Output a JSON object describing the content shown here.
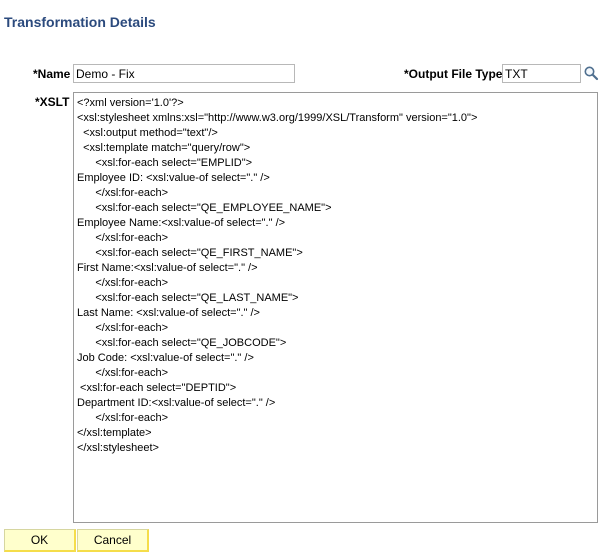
{
  "page": {
    "title": "Transformation Details"
  },
  "form": {
    "name_label": "*Name",
    "name_value": "Demo - Fix",
    "output_file_type_label": "*Output File Type",
    "output_file_type_value": "TXT",
    "lookup_icon": "magnifier-icon",
    "xslt_label": "*XSLT",
    "xslt_value": "<?xml version='1.0'?>\n<xsl:stylesheet xmlns:xsl=\"http://www.w3.org/1999/XSL/Transform\" version=\"1.0\">\n  <xsl:output method=\"text\"/>\n  <xsl:template match=\"query/row\">\n      <xsl:for-each select=\"EMPLID\">\nEmployee ID: <xsl:value-of select=\".\" />\n      </xsl:for-each>\n      <xsl:for-each select=\"QE_EMPLOYEE_NAME\">\nEmployee Name:<xsl:value-of select=\".\" />\n      </xsl:for-each>\n      <xsl:for-each select=\"QE_FIRST_NAME\">\nFirst Name:<xsl:value-of select=\".\" />\n      </xsl:for-each>\n      <xsl:for-each select=\"QE_LAST_NAME\">\nLast Name: <xsl:value-of select=\".\" />\n      </xsl:for-each>\n      <xsl:for-each select=\"QE_JOBCODE\">\nJob Code: <xsl:value-of select=\".\" />\n      </xsl:for-each>\n <xsl:for-each select=\"DEPTID\">\nDepartment ID:<xsl:value-of select=\".\" />\n      </xsl:for-each>\n</xsl:template>\n</xsl:stylesheet>"
  },
  "buttons": {
    "ok_label": "OK",
    "cancel_label": "Cancel"
  },
  "colors": {
    "title": "#2b4a7d",
    "button_bg": "#ffffcc",
    "button_accent": "#f5dd4a"
  }
}
